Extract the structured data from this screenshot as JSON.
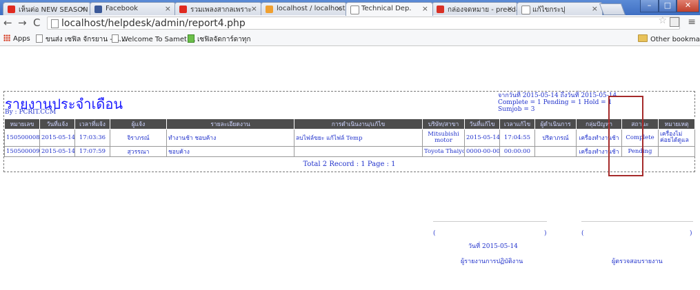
{
  "browser": {
    "tabs": [
      {
        "label": "เห็นต่อ NEW SEASON",
        "icon": "youtube-icon",
        "color": "#e02a20"
      },
      {
        "label": "Facebook",
        "icon": "facebook-icon",
        "color": "#3b5998"
      },
      {
        "label": "รวมเพลงสากลเพราะ",
        "icon": "youtube-icon",
        "color": "#e02a20"
      },
      {
        "label": "localhost / localhost",
        "icon": "phpmyadmin-icon",
        "color": "#f0a030"
      },
      {
        "label": "Technical Dep.",
        "icon": "page-icon",
        "color": "#ffffff"
      },
      {
        "label": "กล่องจดหมาย - preeda",
        "icon": "gmail-icon",
        "color": "#d93025"
      },
      {
        "label": "แก้ไขกระปุ",
        "icon": "page-icon",
        "color": "#ffffff"
      }
    ],
    "url": "localhost/helpdesk/admin/report4.php",
    "bookmarks": {
      "apps": "Apps",
      "items": [
        "ขนส่ง เซฟิล จักรยาน - น...",
        "Welcome To Samet ...",
        "เซฟิลจัดการ์ดาทุก"
      ],
      "other": "Other bookmarks"
    }
  },
  "report": {
    "title": "รายงานประจำเดือน",
    "by": "By : PCRIT.CCM",
    "range": "จากวันที่ 2015-05-14 ถึงวันที่ 2015-05-14",
    "summary": "Complete = 1 Pending = 1 Hold = 1",
    "sumjob": "Sumjob = 3",
    "columns": [
      "หมายเลข",
      "วันที่แจ้ง",
      "เวลาที่แจ้ง",
      "ผู้แจ้ง",
      "รายละเอียดงาน",
      "การดำเนินงาน/แก้ไข",
      "บริษัท/สาขา",
      "วันที่แก้ไข",
      "เวลาแก้ไข",
      "ผู้ดำเนินการ",
      "กลุ่มปัญหา",
      "สถานะ",
      "หมายเหตุ"
    ],
    "rows": [
      [
        "150500008",
        "2015-05-14",
        "17:03:36",
        "จิราภรณ์",
        "ทำงานช้า ชอบค้าง",
        "ลบไฟล์ขยะ แก้ไฟล์ Temp",
        "Mitsubishi motor",
        "2015-05-14",
        "17:04:55",
        "ปริตาภรณ์",
        "เครื่องทำงานช้า",
        "Complete",
        "เครื่องไม่ค่อยได้ดูแล"
      ],
      [
        "150500009",
        "2015-05-14",
        "17:07:59",
        "สุวรรณา",
        "ชอบค้าง",
        "",
        "Toyota Thaiyont",
        "0000-00-00",
        "00:00:00",
        "",
        "เครื่องทำงานช้า",
        "Pending",
        ""
      ]
    ],
    "total": "Total 2 Record : 1 Page : 1"
  },
  "signatures": {
    "left_paren_open": "(",
    "left_paren_close": ")",
    "right_paren_open": "(",
    "right_paren_close": ")",
    "date": "วันที่ 2015-05-14",
    "reporter": "ผู้รายงานการปฏิบัติงาน",
    "checker": "ผู้ตรวจสอบรายงาน"
  }
}
